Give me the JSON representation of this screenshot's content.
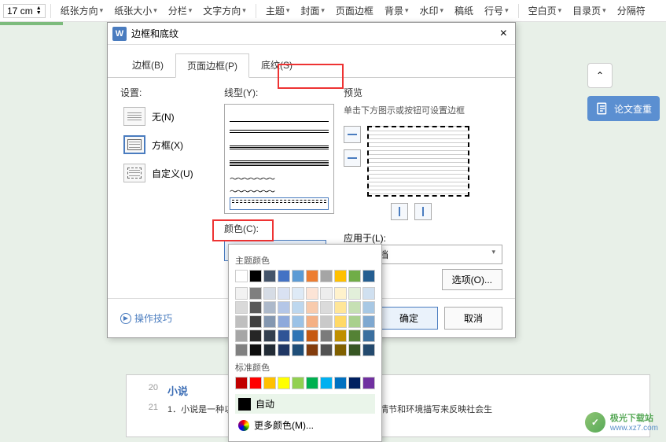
{
  "toolbar": {
    "size_value": "17",
    "size_unit": "cm",
    "items": [
      "纸张方向",
      "纸张大小",
      "分栏",
      "文字方向",
      "主题",
      "封面",
      "页面边框",
      "背景",
      "水印",
      "稿纸",
      "行号",
      "空白页",
      "目录页",
      "分隔符"
    ]
  },
  "dialog": {
    "title": "边框和底纹",
    "tabs": {
      "border": "边框(B)",
      "page_border": "页面边框(P)",
      "shading": "底纹(S)"
    },
    "settings": {
      "label": "设置:",
      "none": "无(N)",
      "box": "方框(X)",
      "custom": "自定义(U)"
    },
    "line_type_label": "线型(Y):",
    "color_label": "颜色(C):",
    "color_value": "自动",
    "preview": {
      "label": "预览",
      "tip": "单击下方图示或按钮可设置边框"
    },
    "apply": {
      "label": "应用于(L):",
      "value": "整篇文档"
    },
    "options_btn": "选项(O)...",
    "tips": "操作技巧",
    "ok": "确定",
    "cancel": "取消"
  },
  "color_popup": {
    "theme_label": "主题颜色",
    "theme_colors_row1": [
      "#ffffff",
      "#000000",
      "#44546a",
      "#4472c4",
      "#5b9bd5",
      "#ed7d31",
      "#a5a5a5",
      "#ffc000",
      "#70ad47",
      "#255e91"
    ],
    "theme_shades": [
      [
        "#f2f2f2",
        "#7f7f7f",
        "#d6dce5",
        "#d9e1f2",
        "#deeaf6",
        "#fce4d6",
        "#ededed",
        "#fff2cc",
        "#e2efda",
        "#d0e0f0"
      ],
      [
        "#d9d9d9",
        "#595959",
        "#adb9ca",
        "#b4c6e7",
        "#bdd7ee",
        "#f8cbad",
        "#dbdbdb",
        "#ffe699",
        "#c6e0b4",
        "#a8c8e4"
      ],
      [
        "#bfbfbf",
        "#404040",
        "#8497b0",
        "#8ea9db",
        "#9bc2e6",
        "#f4b084",
        "#c9c9c9",
        "#ffd966",
        "#a9d08e",
        "#7fa8d0"
      ],
      [
        "#a6a6a6",
        "#262626",
        "#333f4f",
        "#305496",
        "#2f75b5",
        "#c65911",
        "#7b7b7b",
        "#bf8f00",
        "#548235",
        "#3b6f9f"
      ],
      [
        "#808080",
        "#0d0d0d",
        "#222b35",
        "#203764",
        "#1f4e78",
        "#833c0c",
        "#525252",
        "#806000",
        "#375623",
        "#244a6e"
      ]
    ],
    "standard_label": "标准颜色",
    "standard_colors": [
      "#c00000",
      "#ff0000",
      "#ffc000",
      "#ffff00",
      "#92d050",
      "#00b050",
      "#00b0f0",
      "#0070c0",
      "#002060",
      "#7030a0"
    ],
    "auto": "自动",
    "more": "更多颜色(M)..."
  },
  "right_panel": {
    "thesis_check": "论文查重"
  },
  "document": {
    "line20_num": "20",
    "line20_text": "小说",
    "line21_num": "21",
    "line21_text": "1．小说是一种以刻画人物形象为中心、通过完整的故事情节和环境描写来反映社会生"
  },
  "watermark": {
    "name": "极光下载站",
    "url": "www.xz7.com"
  }
}
